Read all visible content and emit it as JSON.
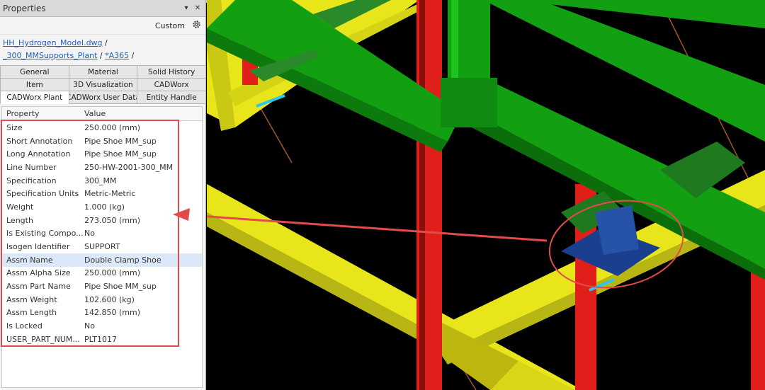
{
  "panel": {
    "title": "Properties",
    "pin_glyph": "▾",
    "close_glyph": "✕",
    "custom_label": "Custom",
    "settings_icon": "gear-icon",
    "breadcrumb": {
      "file": "HH_Hydrogen_Model.dwg",
      "sep1": " /",
      "folder": "_300_MMSupports_Plant",
      "sep2": " /",
      "item": "*A365",
      "sep3": " /"
    },
    "tabs_row1": [
      "General",
      "Material",
      "Solid History"
    ],
    "tabs_row2": [
      "Item",
      "3D Visualization",
      "CADWorx"
    ],
    "tabs_row3": [
      "CADWorx Plant",
      "CADWorx User Data",
      "Entity Handle"
    ],
    "active_tab": "CADWorx Plant",
    "grid": {
      "header_property": "Property",
      "header_value": "Value",
      "rows": [
        {
          "k": "Size",
          "v": "250.000 (mm)"
        },
        {
          "k": "Short Annotation",
          "v": "Pipe Shoe MM_sup"
        },
        {
          "k": "Long Annotation",
          "v": "Pipe Shoe MM_sup"
        },
        {
          "k": "Line Number",
          "v": "250-HW-2001-300_MM"
        },
        {
          "k": "Specification",
          "v": "300_MM"
        },
        {
          "k": "Specification Units",
          "v": "Metric-Metric"
        },
        {
          "k": "Weight",
          "v": "1.000 (kg)"
        },
        {
          "k": "Length",
          "v": "273.050 (mm)"
        },
        {
          "k": "Is Existing Compo...",
          "v": "No"
        },
        {
          "k": "Isogen Identifier",
          "v": "SUPPORT"
        },
        {
          "k": "Assm Name",
          "v": "Double Clamp Shoe"
        },
        {
          "k": "Assm Alpha Size",
          "v": "250.000 (mm)"
        },
        {
          "k": "Assm Part Name",
          "v": "Pipe Shoe MM_sup"
        },
        {
          "k": "Assm Weight",
          "v": "102.600 (kg)"
        },
        {
          "k": "Assm Length",
          "v": "142.850 (mm)"
        },
        {
          "k": "Is Locked",
          "v": "No"
        },
        {
          "k": "USER_PART_NUM...",
          "v": "PLT1017"
        }
      ],
      "highlighted_row": "Assm Name"
    }
  },
  "colors": {
    "pipe_green": "#12a012",
    "beam_yellow": "#e8e61a",
    "column_red": "#e11f1a",
    "shoe_blue": "#1b3f8f",
    "callout_red": "#e34b4b",
    "bar_cyan": "#29c6f0"
  }
}
